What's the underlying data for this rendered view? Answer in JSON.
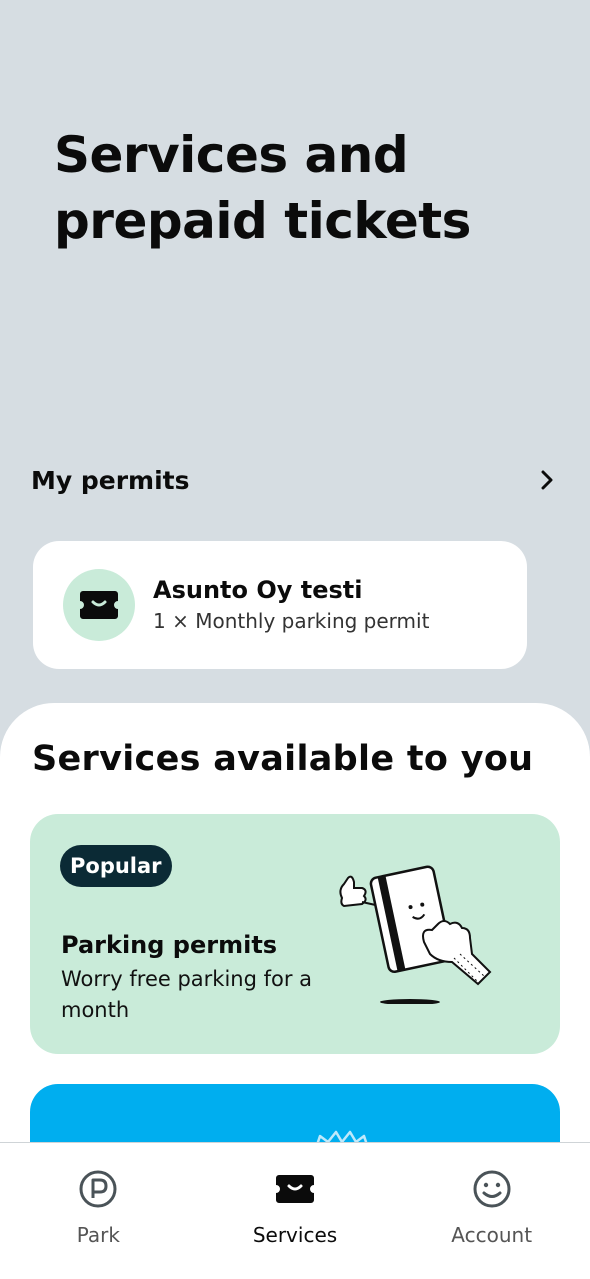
{
  "page": {
    "title": "Services and prepaid tickets"
  },
  "my_permits": {
    "label": "My permits",
    "card": {
      "title": "Asunto Oy testi",
      "subtitle": "1 × Monthly parking permit"
    }
  },
  "services": {
    "title": "Services available to you",
    "cards": [
      {
        "badge": "Popular",
        "title": "Parking permits",
        "description": "Worry free parking for a month",
        "illustration": "hand-holding-card-illustration",
        "background": "#c9ebd9"
      },
      {
        "background": "#00aeef"
      }
    ]
  },
  "tabbar": {
    "items": [
      {
        "label": "Park",
        "icon": "parking-icon",
        "active": false
      },
      {
        "label": "Services",
        "icon": "ticket-icon",
        "active": true
      },
      {
        "label": "Account",
        "icon": "smiley-icon",
        "active": false
      }
    ]
  },
  "colors": {
    "background": "#d6dde2",
    "mint": "#c9ebd9",
    "badge": "#0b2a35",
    "blue": "#00aeef"
  }
}
